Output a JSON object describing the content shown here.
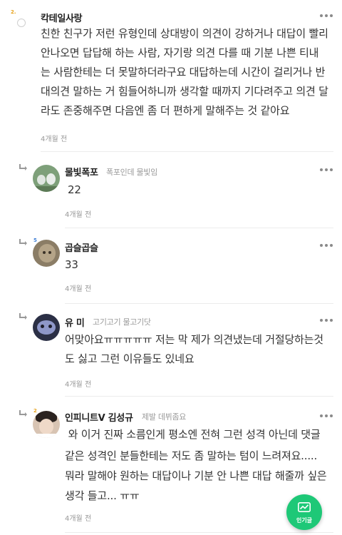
{
  "comments": [
    {
      "level": "2.",
      "author": "칵테일사랑",
      "bio": "",
      "lines": [
        "친한 친구가 저런 유형인데 상대방이 의견이 강하거나 대답이 빨리",
        "안나오면 답답해 하는 사람, 자기랑 의견 다를 때 기분 나쁜 티내",
        "는 사람한테는 더 못말하더라구요 대답하는데 시간이 걸리거나 반",
        "대의견 말하는 거 힘들어하니까 생각할 때까지 기다려주고 의견 달",
        "라도 존중해주면 다음엔 좀 더 편하게 말해주는 것 같아요"
      ],
      "time": "4개월 전"
    },
    {
      "level": "",
      "author": "물빛폭포",
      "bio": "폭포인데 물빛임",
      "lines": [
        "22"
      ],
      "time": "4개월 전"
    },
    {
      "level": "5",
      "author": "곱슬곱슬",
      "bio": "",
      "lines": [
        "33"
      ],
      "time": "4개월 전"
    },
    {
      "level": "",
      "author": "유 미",
      "bio": "고기고기 물고기닷",
      "lines": [
        "어맞아요ㅠㅠㅠㅠㅠ 저는 막 제가 의견냈는데 거절당하는것",
        "도 싫고 그런 이유들도 있네요"
      ],
      "time": "4개월 전"
    },
    {
      "level": "2",
      "author": "인피니트V 김성규",
      "bio": "제발 데뷔좀요",
      "lines": [
        " 와 이거 진짜 소름인게 평소엔 전혀 그런 성격 아닌데 댓글",
        "같은 성격인 분들한테는 저도 좀 말하는 텀이 느려져요.....",
        "뭐라 말해야 원하는 대답이나 기분 안 나쁜 대답 해줄까 싶은",
        "생각 들고... ㅠㅠ"
      ],
      "time": "4개월 전"
    }
  ],
  "fab": {
    "label": "인기글",
    "icon": "trend-chart-icon",
    "color": "#1ec877"
  }
}
